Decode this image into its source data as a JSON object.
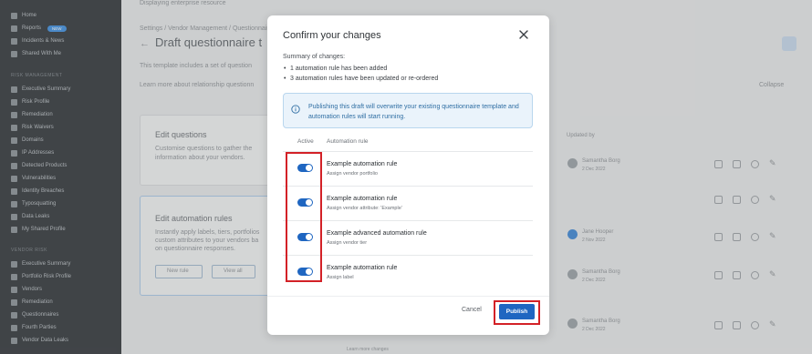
{
  "background": {
    "breadcrumb_top": "Displaying enterprise resource",
    "breadcrumb": "Settings  /  Vendor Management  /  Questionnaire",
    "page_title": "Draft questionnaire t",
    "description": "This template includes a set of question",
    "learn_more": "Learn more about relationship questionn",
    "collapse": "Collapse",
    "card1_title": "Edit questions",
    "card1_text_a": "Customise questions to gather the",
    "card1_text_b": "information about your vendors.",
    "card2_title": "Edit automation rules",
    "card2_text_a": "Instantly apply labels, tiers, portfolios",
    "card2_text_b": "custom attributes to your vendors ba",
    "card2_text_c": "on questionnaire responses.",
    "new_rule": "New rule",
    "view_all": "View all",
    "updated_by_header": "Updated by",
    "rows": [
      {
        "name": "Samantha Borg",
        "date": "2 Dec 2022"
      },
      {
        "name": "",
        "date": ""
      },
      {
        "name": "Jane Hooper",
        "date": "2 Nov 2022"
      },
      {
        "name": "Samantha Borg",
        "date": "2 Dec 2022"
      },
      {
        "name": "Samantha Borg",
        "date": "2 Dec 2022"
      }
    ],
    "bottom_text": "Learn more changes"
  },
  "sidebar": {
    "top_items": [
      "Home",
      "Reports",
      "Incidents & News",
      "Shared With Me"
    ],
    "reports_badge": "NEW",
    "section1": "RISK MANAGEMENT",
    "section1_items": [
      "Executive Summary",
      "Risk Profile",
      "Remediation",
      "Risk Waivers",
      "Domains",
      "IP Addresses",
      "Detected Products",
      "Vulnerabilities",
      "Identity Breaches",
      "Typosquatting",
      "Data Leaks",
      "My Shared Profile"
    ],
    "section2": "VENDOR RISK",
    "section2_items": [
      "Executive Summary",
      "Portfolio Risk Profile",
      "Vendors",
      "Remediation",
      "Questionnaires",
      "Fourth Parties",
      "Vendor Data Leaks"
    ]
  },
  "modal": {
    "title": "Confirm your changes",
    "summary_label": "Summary of changes:",
    "summary_items": [
      "1 automation rule has been added",
      "3 automation rules have been updated or re-ordered"
    ],
    "info_text": "Publishing this draft will overwrite your existing questionnaire template and automation rules will start running.",
    "col_active": "Active",
    "col_rule": "Automation rule",
    "rules": [
      {
        "name": "Example automation rule",
        "sub": "Assign vendor portfolio",
        "active": true
      },
      {
        "name": "Example automation rule",
        "sub": "Assign vendor attribute: 'Example'",
        "active": true
      },
      {
        "name": "Example advanced automation rule",
        "sub": "Assign vendor tier",
        "active": true
      },
      {
        "name": "Example automation rule",
        "sub": "Assign label",
        "active": true
      }
    ],
    "cancel_label": "Cancel",
    "publish_label": "Publish"
  },
  "colors": {
    "primary": "#1f66c1",
    "highlight": "#d32127",
    "info_bg": "#eaf3fb"
  }
}
